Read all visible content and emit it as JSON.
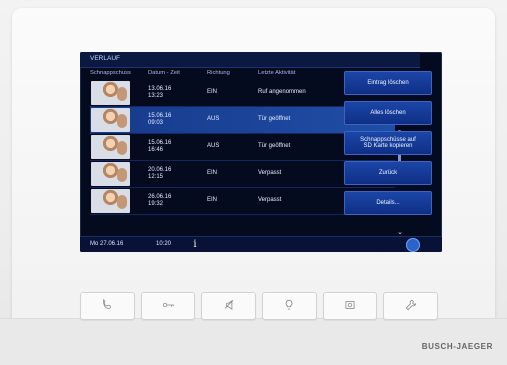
{
  "screen": {
    "title": "VERLAUF",
    "headers": [
      "Schnappschuss",
      "Datum - Zeit",
      "Richtung",
      "Letzte Aktivität"
    ],
    "rows": [
      {
        "date": "13.06.16",
        "time": "13:23",
        "direction": "EIN",
        "activity": "Ruf angenommen",
        "selected": false
      },
      {
        "date": "15.06.16",
        "time": "09:03",
        "direction": "AUS",
        "activity": "Tür geöffnet",
        "selected": true
      },
      {
        "date": "15.06.16",
        "time": "16:46",
        "direction": "AUS",
        "activity": "Tür geöffnet",
        "selected": false
      },
      {
        "date": "20.06.16",
        "time": "12:15",
        "direction": "EIN",
        "activity": "Verpasst",
        "selected": false
      },
      {
        "date": "26.06.16",
        "time": "19:32",
        "direction": "EIN",
        "activity": "Verpasst",
        "selected": false
      }
    ],
    "actions": [
      {
        "label": "Eintrag löschen"
      },
      {
        "label": "Alles löschen"
      },
      {
        "label": "Schnappschüsse auf\nSD Karte kopieren"
      },
      {
        "label": "Zurück"
      },
      {
        "label": "Details..."
      }
    ],
    "status": {
      "date": "Mo 27.06.16",
      "time": "10:20"
    }
  },
  "hardware_keys": [
    {
      "icon": "phone-icon"
    },
    {
      "icon": "key-icon"
    },
    {
      "icon": "mute-icon"
    },
    {
      "icon": "light-icon"
    },
    {
      "icon": "camera-icon"
    },
    {
      "icon": "wrench-icon"
    }
  ],
  "brand": "BUSCH-JAEGER",
  "colors": {
    "screen_bg": "#050b1e",
    "button_blue": "#1b46a7",
    "selected_row": "#1f4ea6"
  }
}
